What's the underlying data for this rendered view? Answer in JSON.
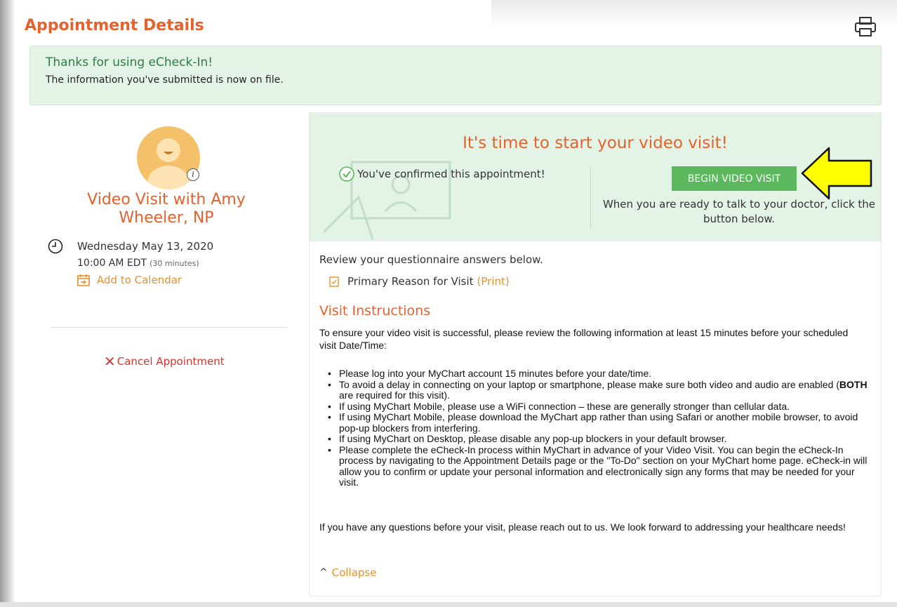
{
  "page": {
    "title": "Appointment Details"
  },
  "banner": {
    "title": "Thanks for using eCheck-In!",
    "text": "The information you've submitted is now on file."
  },
  "appointment": {
    "provider": "Video Visit with Amy Wheeler, NP",
    "date": "Wednesday May 13, 2020",
    "time": "10:00 AM EDT",
    "duration": "(30 minutes)",
    "add_to_calendar": "Add to Calendar",
    "cancel": "Cancel Appointment"
  },
  "video": {
    "heading": "It's time to start your video visit!",
    "confirmed": "You've confirmed this appointment!",
    "begin_button": "BEGIN VIDEO VISIT",
    "begin_note": "When you are ready to talk to your doctor, click the button below."
  },
  "questionnaire": {
    "review_text": "Review your questionnaire answers below.",
    "item": "Primary Reason for Visit",
    "print": "(Print)"
  },
  "instructions": {
    "heading": "Visit Instructions",
    "intro": "To ensure your video visit is successful, please review the following information at least 15 minutes before your scheduled visit Date/Time:",
    "items": [
      "Please log into your MyChart account 15 minutes before your date/time.",
      "are enabled",
      "If using MyChart Mobile, please use a WiFi connection – these are generally stronger than cellular data.",
      "If using MyChart Mobile, please download the MyChart app rather than using Safari or another mobile browser, to avoid pop-up blockers from interfering.",
      "If using MyChart on Desktop, please disable any pop-up blockers in your default browser.",
      "Please complete the eCheck-In process within MyChart in advance of your Video Visit. You can begin the eCheck-In process by navigating to the Appointment Details page or the \"To-Do\" section on your MyChart home page. eCheck-in will allow you to confirm or update your personal information and electronically sign any forms that may be needed for your visit."
    ],
    "item2_before": "To avoid a delay in connecting on your laptop or smartphone, please make sure both video and audio are enabled (",
    "item2_bold": "BOTH",
    "item2_after": " are required for this visit).",
    "outro": "If you have any questions before your visit, please reach out to us. We look forward to addressing your healthcare needs!",
    "collapse": "Collapse"
  },
  "colors": {
    "accent": "#e8612c",
    "link": "#e8912c",
    "success_bg": "#e3f3e6",
    "button": "#5cb85c",
    "cancel": "#d9342b",
    "arrow": "#ffff00"
  }
}
